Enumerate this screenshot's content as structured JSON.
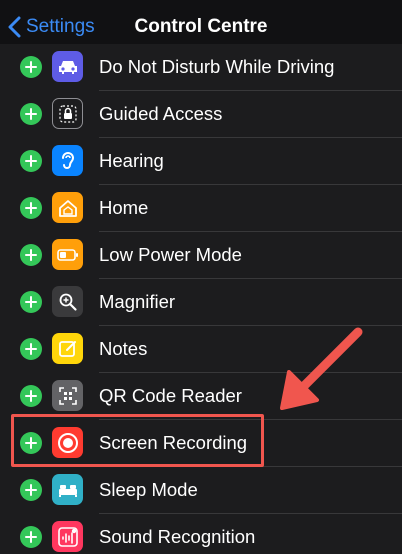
{
  "nav": {
    "back_label": "Settings",
    "title": "Control Centre"
  },
  "colors": {
    "accent": "#3b8bf5",
    "add": "#34c759",
    "annotation": "#f0564e"
  },
  "items": [
    {
      "label": "Do Not Disturb While Driving",
      "icon": "car-icon",
      "color": "#5e5ce6"
    },
    {
      "label": "Guided Access",
      "icon": "lock-icon",
      "color": "#1c1c1e"
    },
    {
      "label": "Hearing",
      "icon": "ear-icon",
      "color": "#0a84ff"
    },
    {
      "label": "Home",
      "icon": "house-icon",
      "color": "#ff9f0a"
    },
    {
      "label": "Low Power Mode",
      "icon": "battery-icon",
      "color": "#ff9f0a"
    },
    {
      "label": "Magnifier",
      "icon": "magnifier-icon",
      "color": "#3a3a3c"
    },
    {
      "label": "Notes",
      "icon": "notes-icon",
      "color": "#ffd60a"
    },
    {
      "label": "QR Code Reader",
      "icon": "qr-code-icon",
      "color": "#636366"
    },
    {
      "label": "Screen Recording",
      "icon": "record-icon",
      "color": "#ff3b30"
    },
    {
      "label": "Sleep Mode",
      "icon": "bed-icon",
      "color": "#30b0c7"
    },
    {
      "label": "Sound Recognition",
      "icon": "waveform-icon",
      "color": "#ff375f"
    }
  ]
}
